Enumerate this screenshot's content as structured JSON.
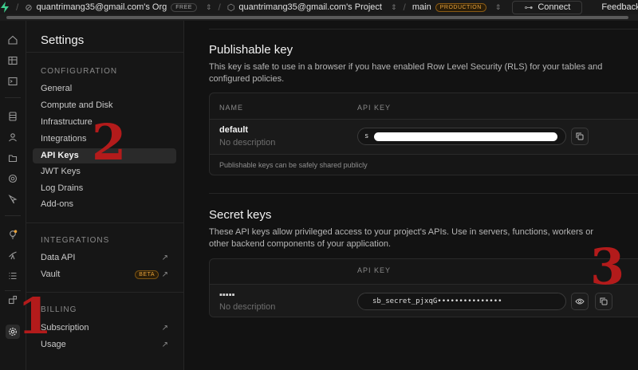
{
  "topbar": {
    "org_name": "quantrimang35@gmail.com's Org",
    "org_plan": "FREE",
    "project_name": "quantrimang35@gmail.com's Project",
    "branch": "main",
    "branch_env": "PRODUCTION",
    "connect_label": "Connect",
    "feedback_label": "Feedback"
  },
  "rail_icons": [
    "home-icon",
    "table-editor-icon",
    "sql-editor-icon",
    "database-icon",
    "auth-icon",
    "storage-icon",
    "realtime-icon",
    "edge-functions-icon",
    "advisors-icon",
    "reports-icon",
    "logs-icon",
    "integrations-icon",
    "settings-icon"
  ],
  "sidebar": {
    "title": "Settings",
    "configuration": {
      "title": "CONFIGURATION",
      "items": [
        "General",
        "Compute and Disk",
        "Infrastructure",
        "Integrations",
        "API Keys",
        "JWT Keys",
        "Log Drains",
        "Add-ons"
      ],
      "active": "API Keys"
    },
    "integrations": {
      "title": "INTEGRATIONS",
      "items": [
        "Data API",
        "Vault"
      ],
      "vault_badge": "BETA"
    },
    "billing": {
      "title": "BILLING",
      "items": [
        "Subscription",
        "Usage"
      ]
    }
  },
  "publishable": {
    "title": "Publishable key",
    "description": "This key is safe to use in a browser if you have enabled Row Level Security (RLS) for your tables and configured policies.",
    "col_name": "NAME",
    "col_key": "API KEY",
    "key_name": "default",
    "key_desc": "No description",
    "key_prefix": "s",
    "footnote": "Publishable keys can be safely shared publicly"
  },
  "secret": {
    "title": "Secret keys",
    "description": "These API keys allow privileged access to your project's APIs. Use in servers, functions, workers or other backend components of your application.",
    "col_key": "API KEY",
    "key_desc": "No description",
    "key_value": "sb_secret_pjxqG•••••••••••••••"
  },
  "annotations": {
    "step1": "1",
    "step2": "2",
    "step3": "3"
  },
  "colors": {
    "accent": "#3ecf8e",
    "annotation": "#b31b1b",
    "warning": "#e8a23a"
  }
}
